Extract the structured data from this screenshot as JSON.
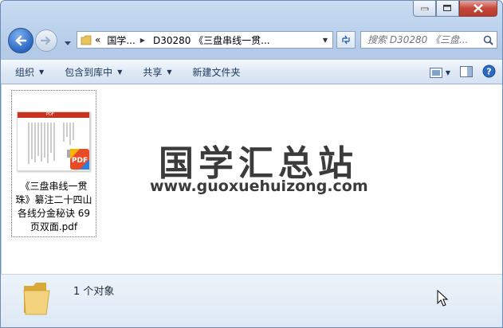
{
  "nav": {
    "address_prefix": "«",
    "crumbs": [
      "国学...",
      "D30280 《三盘串线一贯..."
    ],
    "search_placeholder": "搜索 D30280 《三盘..."
  },
  "toolbar": {
    "organize": "组织",
    "include_library": "包含到库中",
    "share": "共享",
    "new_folder": "新建文件夹"
  },
  "file": {
    "name_lines": [
      "《三盘串线一贯",
      "珠》纂注二十四山",
      "各线分金秘诀 69",
      "页双面.pdf"
    ],
    "thumb_header": "PDF",
    "badge": "PDF"
  },
  "watermark": {
    "title": "国学汇总站",
    "url": "www.guoxuehuizong.com"
  },
  "details": {
    "count": "1 个对象"
  },
  "colors": {
    "frame": "#b4cbe8",
    "toolbar_text": "#1e395b",
    "pdf_red": "#c8321f"
  }
}
